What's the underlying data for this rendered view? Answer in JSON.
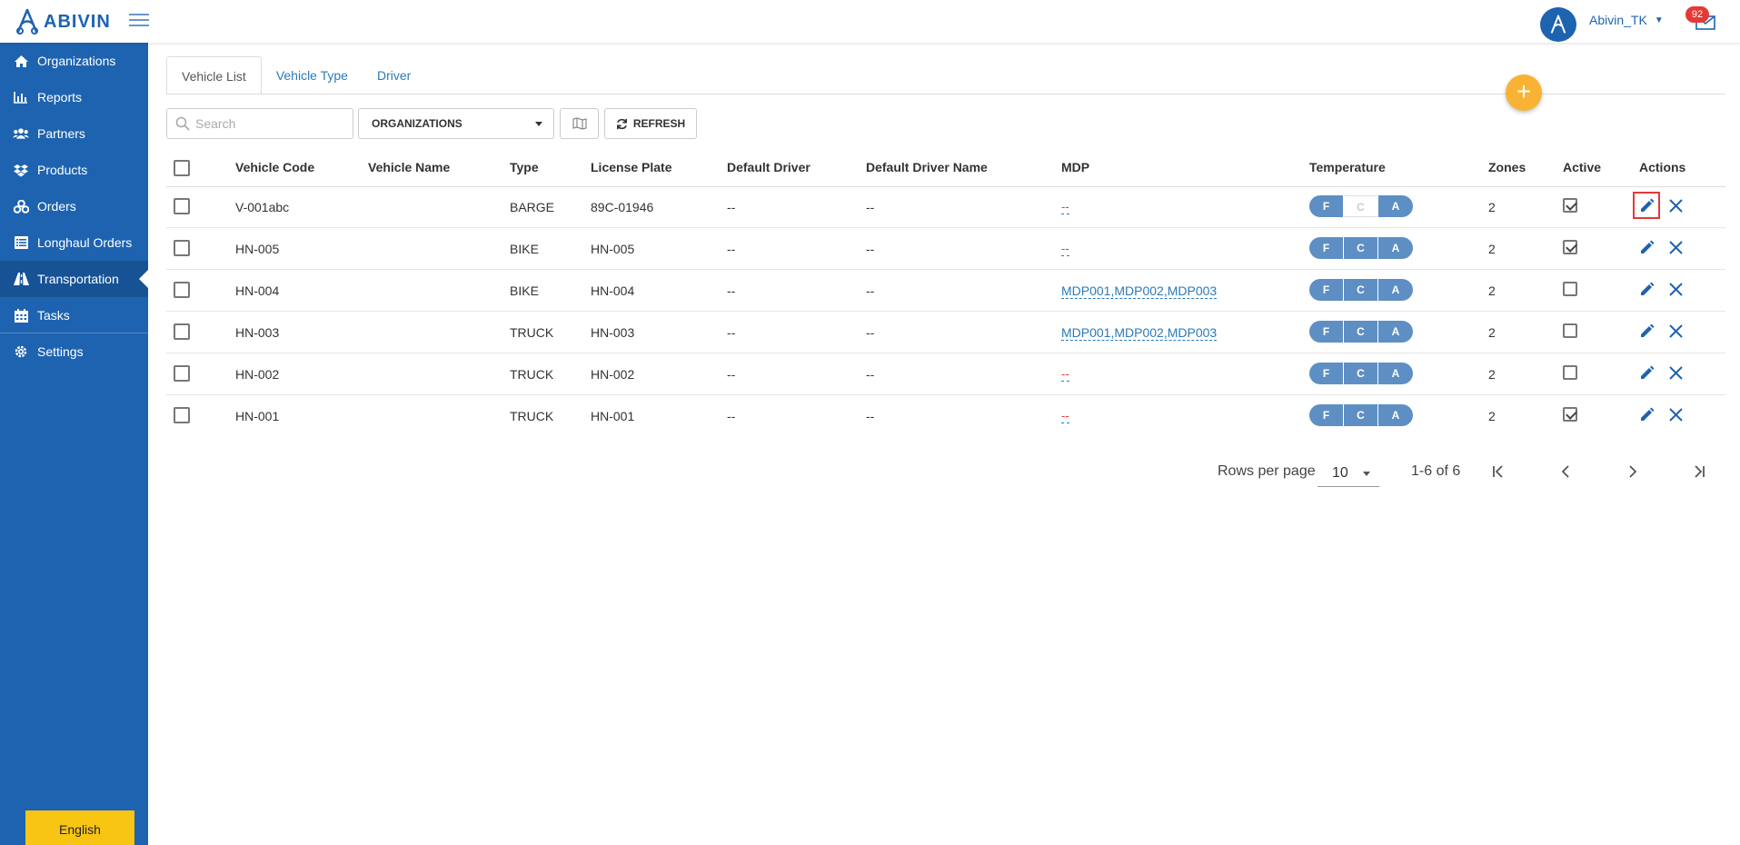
{
  "app": {
    "brand": "ABIVIN"
  },
  "header": {
    "username": "Abivin_TK",
    "mail_count": "92"
  },
  "sidebar": {
    "items": [
      {
        "label": "Organizations",
        "icon": "home-icon"
      },
      {
        "label": "Reports",
        "icon": "bar-chart-icon"
      },
      {
        "label": "Partners",
        "icon": "users-icon"
      },
      {
        "label": "Products",
        "icon": "dropbox-icon"
      },
      {
        "label": "Orders",
        "icon": "cubes-icon"
      },
      {
        "label": "Longhaul Orders",
        "icon": "list-icon"
      },
      {
        "label": "Transportation",
        "icon": "road-icon"
      },
      {
        "label": "Tasks",
        "icon": "calendar-icon"
      },
      {
        "label": "Settings",
        "icon": "gear-icon"
      }
    ],
    "active_item": "Transportation",
    "language": "English"
  },
  "tabs": [
    {
      "label": "Vehicle List",
      "active": true
    },
    {
      "label": "Vehicle Type",
      "active": false
    },
    {
      "label": "Driver",
      "active": false
    }
  ],
  "toolbar": {
    "search_placeholder": "Search",
    "organizations_label": "ORGANIZATIONS",
    "refresh_label": "REFRESH"
  },
  "table": {
    "columns": [
      "Vehicle Code",
      "Vehicle Name",
      "Type",
      "License Plate",
      "Default Driver",
      "Default Driver Name",
      "MDP",
      "Temperature",
      "Zones",
      "Active",
      "Actions"
    ],
    "rows": [
      {
        "code": "V-001abc",
        "name": "",
        "type": "BARGE",
        "plate": "89C-01946",
        "driver": "--",
        "driver_name": "--",
        "mdp": "--",
        "temp": {
          "F": true,
          "C": false,
          "A": true
        },
        "zones": "2",
        "active": true
      },
      {
        "code": "HN-005",
        "name": "",
        "type": "BIKE",
        "plate": "HN-005",
        "driver": "--",
        "driver_name": "--",
        "mdp": "--",
        "temp": {
          "F": true,
          "C": true,
          "A": true
        },
        "zones": "2",
        "active": true
      },
      {
        "code": "HN-004",
        "name": "",
        "type": "BIKE",
        "plate": "HN-004",
        "driver": "--",
        "driver_name": "--",
        "mdp": "MDP001,MDP002,MDP003",
        "temp": {
          "F": true,
          "C": true,
          "A": true
        },
        "zones": "2",
        "active": false
      },
      {
        "code": "HN-003",
        "name": "",
        "type": "TRUCK",
        "plate": "HN-003",
        "driver": "--",
        "driver_name": "--",
        "mdp": "MDP001,MDP002,MDP003",
        "temp": {
          "F": true,
          "C": true,
          "A": true
        },
        "zones": "2",
        "active": false
      },
      {
        "code": "HN-002",
        "name": "",
        "type": "TRUCK",
        "plate": "HN-002",
        "driver": "--",
        "driver_name": "--",
        "mdp": "--",
        "temp": {
          "F": true,
          "C": true,
          "A": true
        },
        "zones": "2",
        "active": false
      },
      {
        "code": "HN-001",
        "name": "",
        "type": "TRUCK",
        "plate": "HN-001",
        "driver": "--",
        "driver_name": "--",
        "mdp": "--",
        "temp": {
          "F": true,
          "C": true,
          "A": true
        },
        "zones": "2",
        "active": true
      }
    ],
    "temp_labels": [
      "F",
      "C",
      "A"
    ]
  },
  "pagination": {
    "rows_per_page_label": "Rows per page",
    "rows_per_page": "10",
    "range": "1-6 of 6"
  },
  "colors": {
    "primary": "#1e63b0",
    "accent": "#f9b233",
    "language_button": "#f9c513",
    "temp_chip": "#5e8fc4",
    "badge": "#e53935"
  }
}
